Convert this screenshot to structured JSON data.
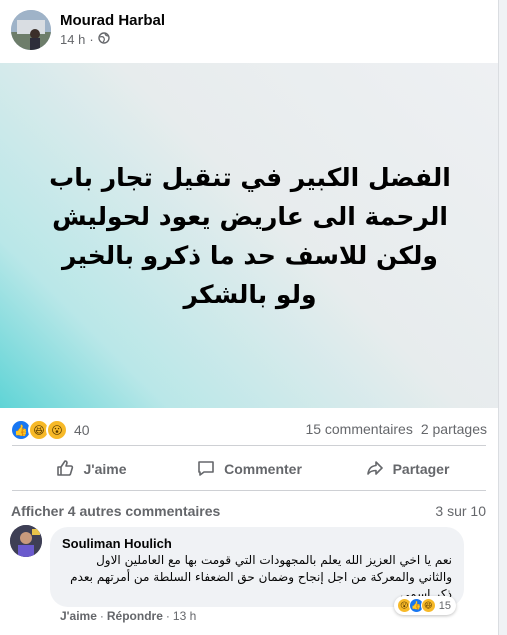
{
  "post": {
    "author": "Mourad Harbal",
    "time": "14 h",
    "separator": "·",
    "banner_text": "الفضل الكبير في تنقيل تجار باب الرحمة الى عاريض يعود لحوليش ولكن للاسف حد ما ذكرو بالخير ولو بالشكر",
    "reaction_count": "40",
    "comments_count": "15 commentaires",
    "shares_count": "2 partages",
    "reaction_icons": [
      "like-icon",
      "haha-icon",
      "wow-icon"
    ]
  },
  "actions": {
    "like": "J'aime",
    "comment": "Commenter",
    "share": "Partager"
  },
  "comments": {
    "more_label": "Afficher 4 autres commentaires",
    "pager": "3 sur 10",
    "item": {
      "author": "Souliman Houlich",
      "text": "نعم يا اخي العزيز الله يعلم بالمجهودات التي قومت بها مع العاملين الاول والثاني والمعركة من اجل إنجاح وضمان حق الضعفاء السلطة من أمرتهم بعدم ذكر اسمي",
      "reaction_count": "15",
      "like": "J'aime",
      "reply": "Répondre",
      "sep": "·",
      "time": "13 h"
    }
  },
  "colors": {
    "accent": "#1877f2",
    "secondary_text": "#65676b"
  }
}
